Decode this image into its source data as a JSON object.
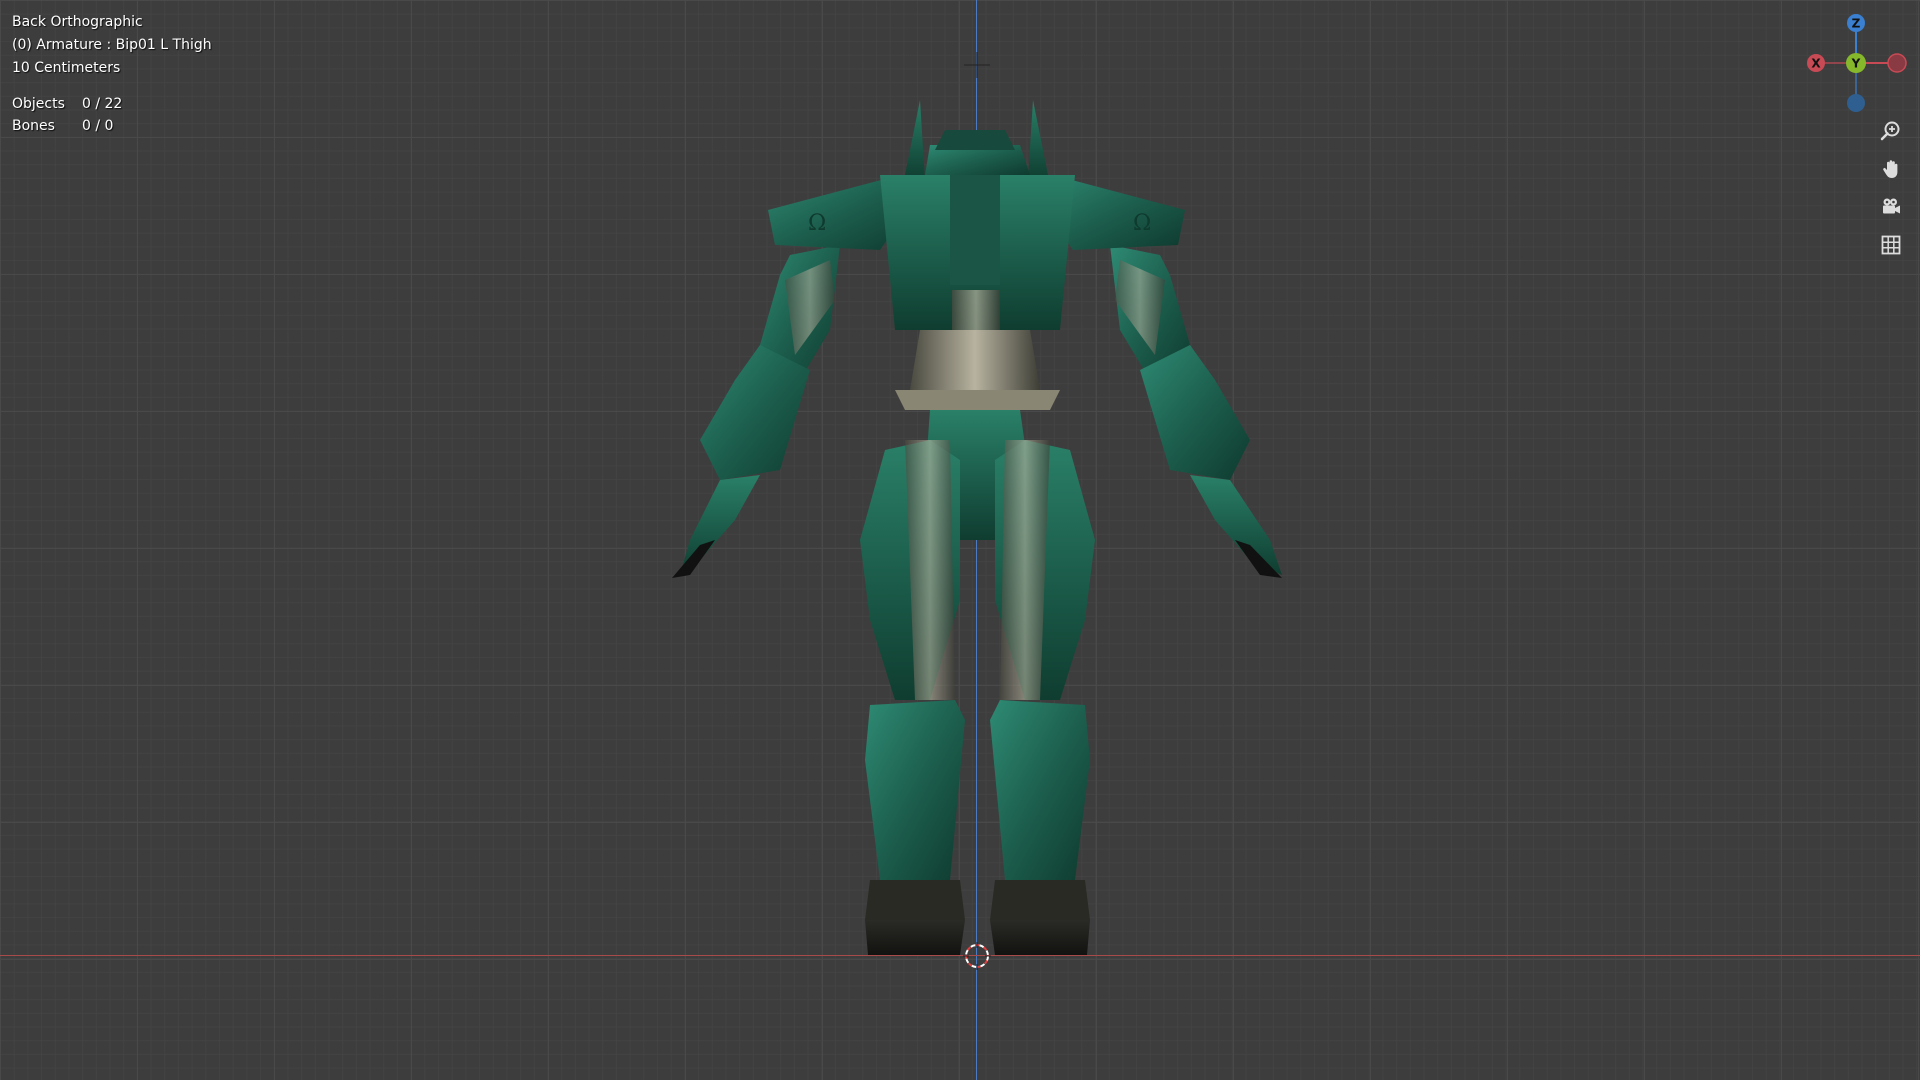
{
  "viewport": {
    "view_name": "Back Orthographic",
    "active_object": "(0) Armature : Bip01 L Thigh",
    "scale": "10 Centimeters",
    "stats": [
      {
        "label": "Objects",
        "value": "0 / 22"
      },
      {
        "label": "Bones",
        "value": "0 / 0"
      }
    ]
  },
  "gizmo": {
    "z_label": "Z",
    "x_label": "X",
    "y_label": "Y",
    "colors": {
      "x": "#c84a55",
      "y": "#86b82c",
      "z": "#3a7fd0"
    }
  },
  "nav_buttons": [
    {
      "name": "zoom",
      "icon": "zoom-in-icon"
    },
    {
      "name": "pan",
      "icon": "hand-icon"
    },
    {
      "name": "camera",
      "icon": "camera-icon"
    },
    {
      "name": "perspective",
      "icon": "grid-icon"
    }
  ],
  "colors": {
    "background": "#3d3d3d",
    "grid": "#4a4a4a",
    "z_axis_line": "#4a7bc4",
    "x_axis_line": "#a84a4a",
    "model_green": "#1e5c4c"
  }
}
